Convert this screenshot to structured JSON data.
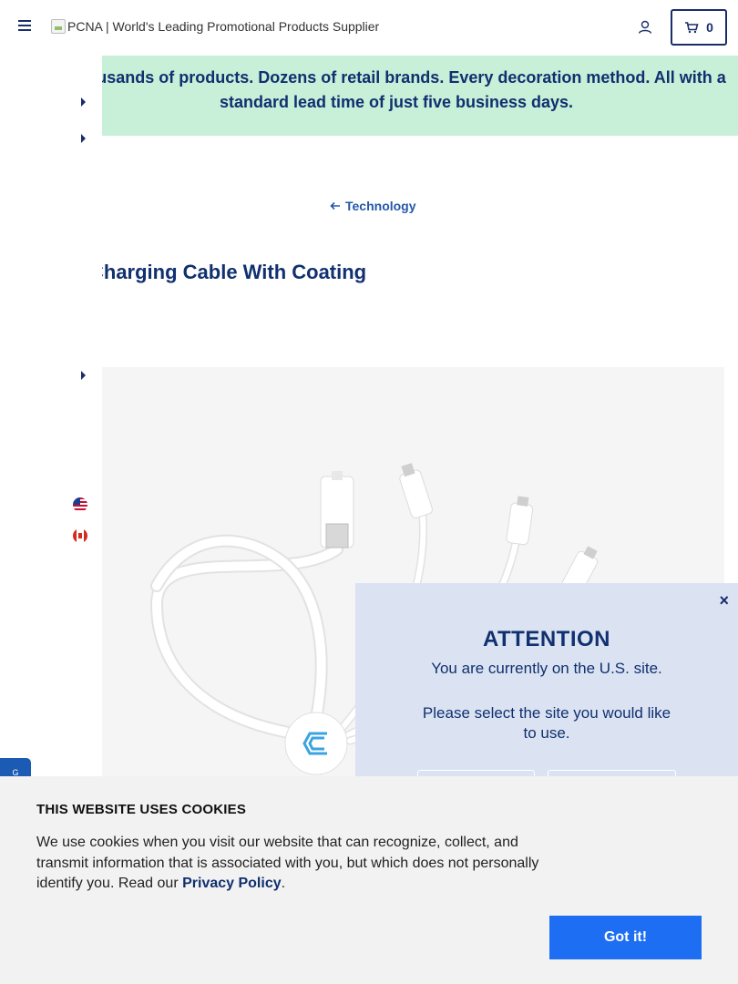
{
  "header": {
    "logo_alt": "PCNA | World's Leading Promotional Products Supplier",
    "cart_count": "0"
  },
  "promo": {
    "text": "Thousands of products. Dozens of retail brands. Every decoration method. All with a standard lead time of just five business days."
  },
  "breadcrumb": {
    "back_label": "Technology"
  },
  "product": {
    "title": "Charging Cable With Coating"
  },
  "modal": {
    "close_symbol": "×",
    "title": "ATTENTION",
    "line1": "You are currently on the U.S. site.",
    "line2": "Please select the site you would like to use."
  },
  "side_tab": {
    "label": "G"
  },
  "cookie": {
    "title": "THIS WEBSITE USES COOKIES",
    "body": "We use cookies when you visit our website that can recognize, collect, and transmit information that is associated with you, but which does not personally identify you. Read our ",
    "link": "Privacy Policy",
    "end": ".",
    "button": "Got it!"
  },
  "colors": {
    "brand_navy": "#10306f",
    "promo_bg": "#c8efd8",
    "modal_bg": "#dbe3f3",
    "cookie_button": "#1e6ef4",
    "link_blue": "#2458a8"
  }
}
